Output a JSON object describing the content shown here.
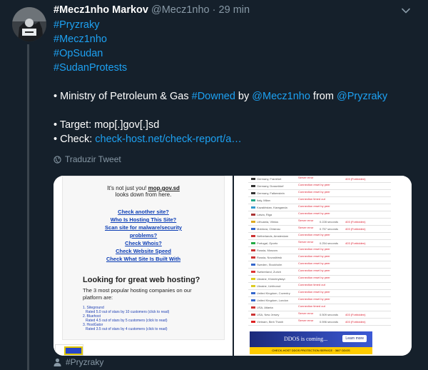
{
  "tweet": {
    "name": "#Mecz1nho Markov",
    "handle": "@Mecz1nho",
    "separator": "·",
    "time": "29 min",
    "body_lines": [
      {
        "type": "link",
        "text": "#Pryzraky"
      },
      {
        "type": "link",
        "text": "#Mecz1nho"
      },
      {
        "type": "link",
        "text": "#OpSudan"
      },
      {
        "type": "link",
        "text": "#SudanProtests"
      }
    ],
    "ministry": {
      "prefix": "• Ministry of Petroleum & Gas ",
      "tag": "#Downed",
      "by": " by ",
      "user": "@Mecz1nho",
      "from": " from ",
      "group": "@Pryzraky"
    },
    "target": "• Target: mop[.]gov[.]sd",
    "check_prefix": "• Check: ",
    "check_link": "check-host.net/check-report/a…",
    "translate": "Traduzir Tweet",
    "footer_tag": "#Pryzraky"
  },
  "image_left": {
    "notice_prefix": "It's not just you!",
    "notice_domain": "mop.gov.sd",
    "notice_suffix": "looks down from here.",
    "links": [
      "Check another site?",
      "Who Is Hosting This Site?",
      "Scan site for malware/security problems?",
      "Check Whois?",
      "Check Website Speed",
      "Check What Site Is Built With"
    ],
    "heading": "Looking for great web hosting?",
    "subtext": "The 3 most popular hosting companies on our platform are:",
    "hosts": [
      "1. Siteground",
      "Rated 5.0 out of stars by 10 customers (click to read)",
      "2. Bluehost",
      "Rated 4.5 out of stars by 5 customers (click to read)",
      "3. HostGator",
      "Rated 3.5 out of stars by 4 customers (click to read)"
    ]
  },
  "image_right": {
    "rows": [
      {
        "loc": "Germany, Frankfurt",
        "result": "Server error",
        "time": "",
        "code": "403 (Forbidden)",
        "color": "#333"
      },
      {
        "loc": "Germany, Dusseldorf",
        "result": "Connection reset by peer",
        "time": "",
        "code": "",
        "color": "#333"
      },
      {
        "loc": "Germany, Falkenstein",
        "result": "Connection reset by peer",
        "time": "",
        "code": "",
        "color": "#333"
      },
      {
        "loc": "Italy, Milan",
        "result": "Connection timed out",
        "time": "",
        "code": "",
        "color": "#2a8"
      },
      {
        "loc": "Kazakhstan, Karaganda",
        "result": "Connection reset by peer",
        "time": "",
        "code": "",
        "color": "#39c"
      },
      {
        "loc": "Latvia, Riga",
        "result": "Connection reset by peer",
        "time": "",
        "code": "",
        "color": "#a33"
      },
      {
        "loc": "Lithuania, Vilnius",
        "result": "Server error",
        "time": "0.228 seconds",
        "code": "403 (Forbidden)",
        "color": "#da2"
      },
      {
        "loc": "Moldova, Chisinau",
        "result": "Server error",
        "time": "0.757 seconds",
        "code": "403 (Forbidden)",
        "color": "#36c"
      },
      {
        "loc": "Netherlands, Amsterdam",
        "result": "Connection reset by peer",
        "time": "",
        "code": "",
        "color": "#c33"
      },
      {
        "loc": "Portugal, Oporto",
        "result": "Server error",
        "time": "0.254 seconds",
        "code": "403 (Forbidden)",
        "color": "#2a4"
      },
      {
        "loc": "Russia, Moscow",
        "result": "Connection reset by peer",
        "time": "",
        "code": "",
        "color": "#c33"
      },
      {
        "loc": "Russia, Novosibirsk",
        "result": "Connection reset by peer",
        "time": "",
        "code": "",
        "color": "#c33"
      },
      {
        "loc": "Sweden, Stockholm",
        "result": "Connection reset by peer",
        "time": "",
        "code": "",
        "color": "#36c"
      },
      {
        "loc": "Switzerland, Zurich",
        "result": "Connection reset by peer",
        "time": "",
        "code": "",
        "color": "#d33"
      },
      {
        "loc": "Ukraine, Khmelnytskyi",
        "result": "Connection reset by peer",
        "time": "",
        "code": "",
        "color": "#dc2"
      },
      {
        "loc": "Ukraine, Uzhhorod",
        "result": "Connection timed out",
        "time": "",
        "code": "",
        "color": "#dc2"
      },
      {
        "loc": "United Kingdom, Coventry",
        "result": "Connection reset by peer",
        "time": "",
        "code": "",
        "color": "#36c"
      },
      {
        "loc": "United Kingdom, London",
        "result": "Connection reset by peer",
        "time": "",
        "code": "",
        "color": "#36c"
      },
      {
        "loc": "USA, Atlanta",
        "result": "Connection timed out",
        "time": "",
        "code": "",
        "color": "#c33"
      },
      {
        "loc": "USA, New Jersey",
        "result": "Server error",
        "time": "0.509 seconds",
        "code": "403 (Forbidden)",
        "color": "#c33"
      },
      {
        "loc": "Vietnam, Binh Thanh",
        "result": "Server error",
        "time": "0.596 seconds",
        "code": "403 (Forbidden)",
        "color": "#d22"
      }
    ],
    "banner_title": "DDOS is coming...",
    "banner_button": "Learn more",
    "banner_bar": "CHECK-HOST DDOS PROTECTION SERVICE · 360° DDOS"
  },
  "colors": {
    "background": "#15202b",
    "link": "#1da1f2",
    "muted": "#8899a6"
  }
}
